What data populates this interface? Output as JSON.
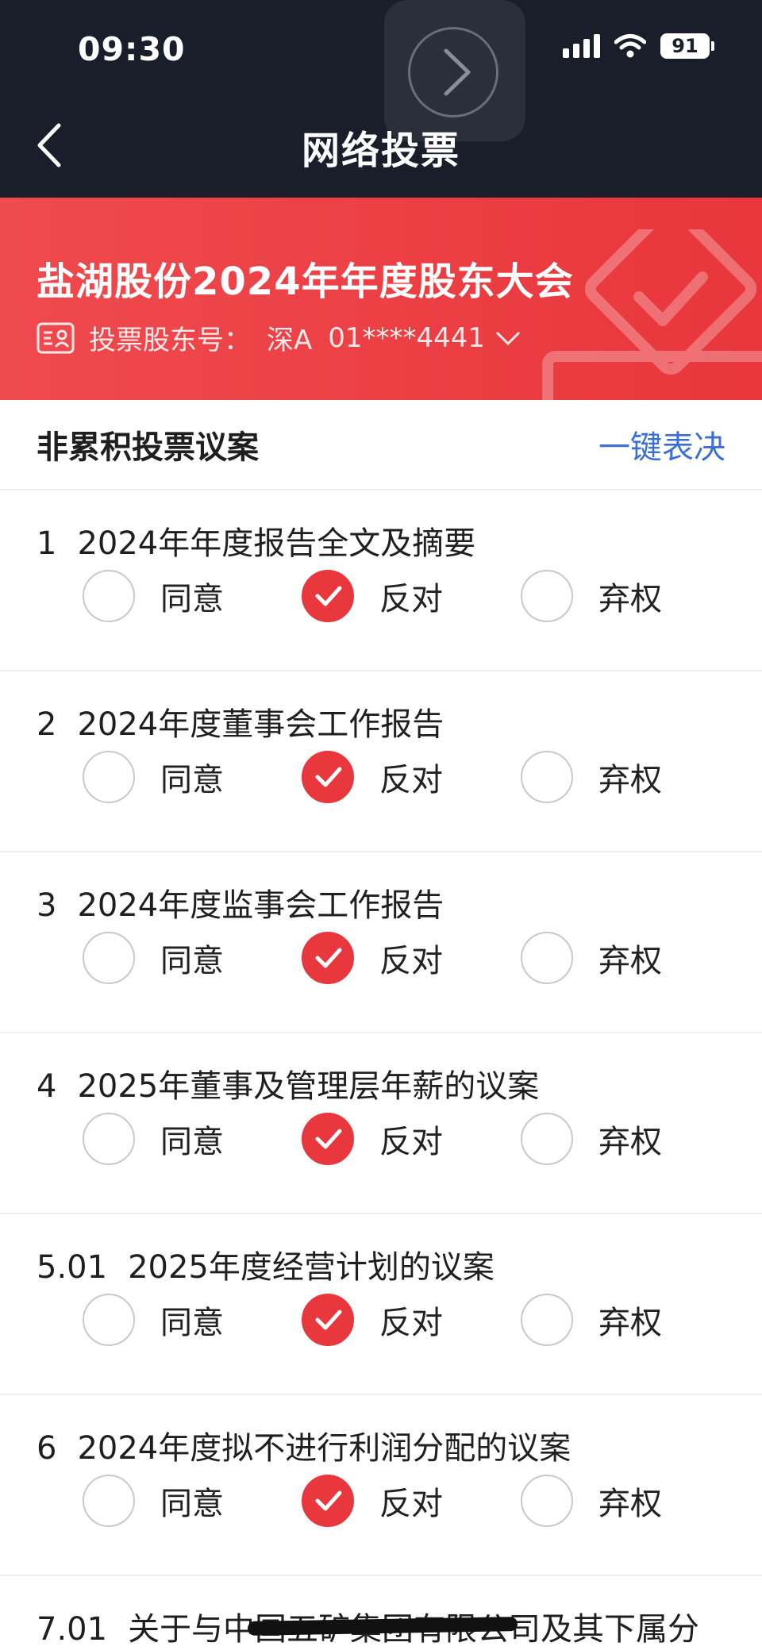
{
  "status_bar": {
    "time": "09:30",
    "battery": "91"
  },
  "nav": {
    "title": "网络投票"
  },
  "banner": {
    "meeting_title": "盐湖股份2024年年度股东大会",
    "holder_label": "投票股东号：",
    "market": "深A",
    "account": "01****4441"
  },
  "section": {
    "title": "非累积投票议案",
    "quick_vote": "一键表决"
  },
  "option_labels": {
    "agree": "同意",
    "oppose": "反对",
    "abstain": "弃权"
  },
  "motions": [
    {
      "num": "1",
      "title": "2024年年度报告全文及摘要",
      "selected": "oppose"
    },
    {
      "num": "2",
      "title": "2024年度董事会工作报告",
      "selected": "oppose"
    },
    {
      "num": "3",
      "title": "2024年度监事会工作报告",
      "selected": "oppose"
    },
    {
      "num": "4",
      "title": "2025年董事及管理层年薪的议案",
      "selected": "oppose"
    },
    {
      "num": "5.01",
      "title": "2025年度经营计划的议案",
      "selected": "oppose"
    },
    {
      "num": "6",
      "title": "2024年度拟不进行利润分配的议案",
      "selected": "oppose"
    },
    {
      "num": "7.01",
      "title": "关于与中国五矿集团有限公司及其下属分"
    }
  ],
  "colors": {
    "accent": "#e8373d",
    "link": "#3b6fd4",
    "topbar": "#1a1e2b"
  }
}
